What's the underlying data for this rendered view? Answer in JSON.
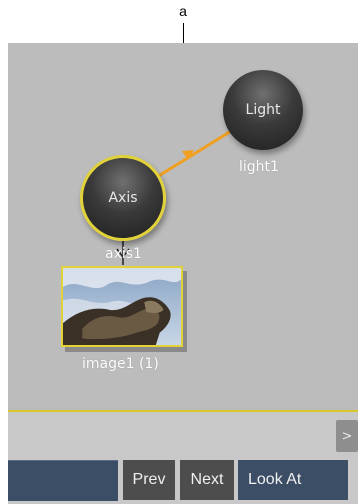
{
  "callout": {
    "label": "a"
  },
  "nodes": {
    "light": {
      "title": "Light",
      "name": "light1"
    },
    "axis": {
      "title": "Axis",
      "name": "axis1"
    },
    "image": {
      "name": "image1 (1)"
    }
  },
  "scroll_button": {
    "label": ">"
  },
  "toolbar": {
    "prev_label": "Prev",
    "next_label": "Next",
    "look_at_label": "Look At"
  },
  "colors": {
    "canvas_bg": "#bcbcbc",
    "selection_yellow": "#e2d23a",
    "link_orange": "#f0a020",
    "field_blue": "#3c4e66",
    "button_gray": "#4d4d4d"
  }
}
